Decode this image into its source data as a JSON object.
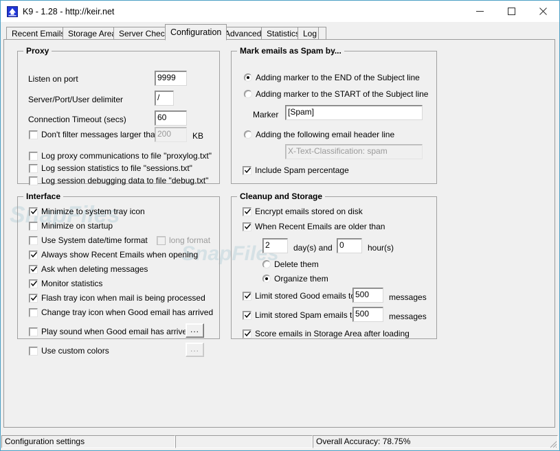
{
  "window": {
    "title": "K9 - 1.28 - http://keir.net",
    "icon": "k9-app-icon",
    "minimize_label": "─",
    "maximize_label": "□",
    "close_label": "✕"
  },
  "tabs": [
    {
      "label": "Recent Emails",
      "active": false
    },
    {
      "label": "Storage Area",
      "active": false
    },
    {
      "label": "Server Check",
      "active": false
    },
    {
      "label": "Configuration",
      "active": true
    },
    {
      "label": "Advanced",
      "active": false
    },
    {
      "label": "Statistics",
      "active": false
    },
    {
      "label": "Log",
      "active": false
    }
  ],
  "proxy": {
    "title": "Proxy",
    "listen_port_label": "Listen on port",
    "listen_port_value": "9999",
    "delimiter_label": "Server/Port/User delimiter",
    "delimiter_value": "/",
    "timeout_label": "Connection Timeout (secs)",
    "timeout_value": "60",
    "dont_filter_label": "Don't filter messages larger than",
    "dont_filter_checked": false,
    "dont_filter_size_value": "200",
    "dont_filter_units": "KB",
    "log_proxy_label": "Log proxy communications to file \"proxylog.txt\"",
    "log_proxy_checked": false,
    "log_stats_label": "Log session statistics to file \"sessions.txt\"",
    "log_stats_checked": false,
    "log_debug_label": "Log session debugging data to file \"debug.txt\"",
    "log_debug_checked": false
  },
  "interface": {
    "title": "Interface",
    "items": [
      {
        "label": "Minimize to system tray icon",
        "checked": true,
        "disabled": false
      },
      {
        "label": "Minimize on startup",
        "checked": false,
        "disabled": false
      },
      {
        "label": "Use System date/time format",
        "checked": false,
        "disabled": false
      },
      {
        "label": "Always show Recent Emails when opening",
        "checked": true,
        "disabled": false
      },
      {
        "label": "Ask when deleting messages",
        "checked": true,
        "disabled": false
      },
      {
        "label": "Monitor statistics",
        "checked": true,
        "disabled": false
      },
      {
        "label": "Flash tray icon when mail is being processed",
        "checked": true,
        "disabled": false
      },
      {
        "label": "Change tray icon when Good email has arrived",
        "checked": false,
        "disabled": false
      },
      {
        "label": "Play sound when Good email has arrived",
        "checked": false,
        "disabled": false
      },
      {
        "label": "Use custom colors",
        "checked": false,
        "disabled": false
      }
    ],
    "long_format_label": "long format",
    "long_format_checked": false,
    "browse_sound_label": "...",
    "browse_colors_label": "..."
  },
  "spam": {
    "title": "Mark emails as Spam by...",
    "option_end_label": "Adding marker to the END of the Subject line",
    "option_start_label": "Adding marker to the START of the Subject line",
    "option_header_label": "Adding the following email header line",
    "selected_option": "end",
    "marker_label": "Marker",
    "marker_value": "[Spam]",
    "header_value": "X-Text-Classification: spam",
    "include_percentage_label": "Include Spam percentage",
    "include_percentage_checked": true
  },
  "cleanup": {
    "title": "Cleanup and Storage",
    "encrypt_label": "Encrypt emails stored on disk",
    "encrypt_checked": true,
    "older_than_label": "When Recent Emails are older than",
    "older_than_checked": true,
    "days_value": "2",
    "days_unit_label": "day(s) and",
    "hours_value": "0",
    "hours_unit_label": "hour(s)",
    "delete_them_label": "Delete them",
    "organize_them_label": "Organize them",
    "selected_action": "organize",
    "limit_good_label": "Limit stored Good emails to",
    "limit_good_checked": true,
    "limit_good_value": "500",
    "limit_good_unit": "messages",
    "limit_spam_label": "Limit stored Spam emails to",
    "limit_spam_checked": true,
    "limit_spam_value": "500",
    "limit_spam_unit": "messages",
    "score_label": "Score emails in Storage Area after loading",
    "score_checked": true
  },
  "statusbar": {
    "left": "Configuration settings",
    "middle": "",
    "right": "Overall Accuracy: 78.75%"
  },
  "watermark": {
    "text": "SnapFiles"
  },
  "colors": {
    "accent": "#4b9fc4",
    "face": "#f0f0f0",
    "border": "#a0a0a0",
    "disabled_text": "#9a9a9a",
    "icon_blue": "#1f36d8"
  }
}
